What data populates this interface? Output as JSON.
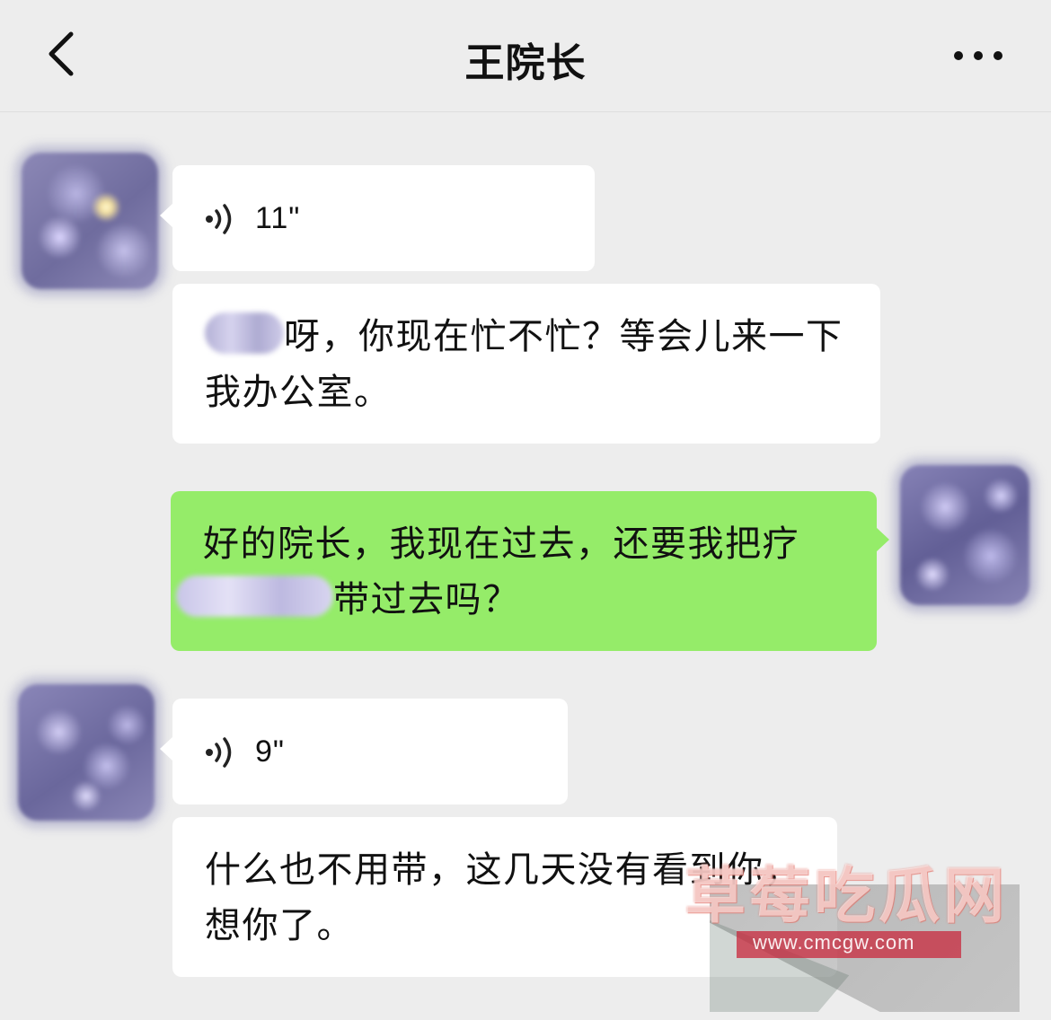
{
  "header": {
    "title": "王院长",
    "back_icon": "chevron-left-icon",
    "more_icon": "more-dots-icon"
  },
  "messages": [
    {
      "sender": "contact",
      "type": "voice",
      "duration": "11\""
    },
    {
      "sender": "contact",
      "type": "text",
      "text_before": "",
      "text_after": "呀，你现在忙不忙？等会儿来一下我办公室。"
    },
    {
      "sender": "me",
      "type": "text",
      "text_before": "好的院长，我现在过去，还要我把疗",
      "text_after": "带过去吗？"
    },
    {
      "sender": "contact",
      "type": "voice",
      "duration": "9\""
    },
    {
      "sender": "contact",
      "type": "text",
      "text": "什么也不用带，这几天没有看到你，想你了。"
    }
  ],
  "watermark": {
    "title": "草莓吃瓜网",
    "url": "www.cmcgw.com"
  },
  "colors": {
    "background": "#ededed",
    "bubble_incoming": "#ffffff",
    "bubble_outgoing": "#95ec69"
  }
}
